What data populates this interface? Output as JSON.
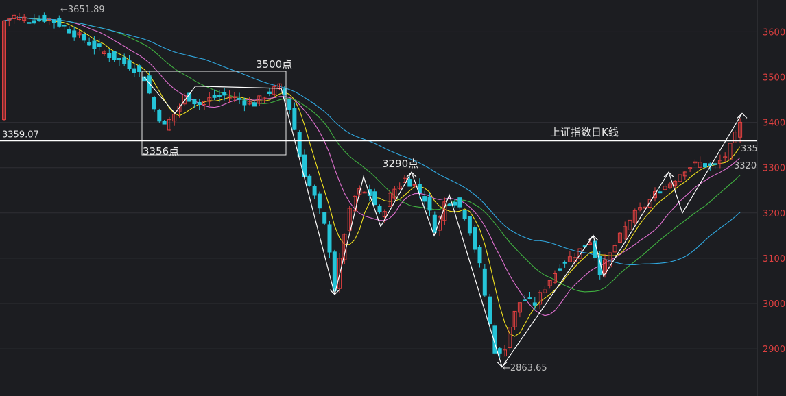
{
  "chart_data": {
    "type": "candlestick",
    "title": "上证指数日K线",
    "ylim": [
      2820,
      3680
    ],
    "y_ticks": [
      2900,
      3000,
      3100,
      3200,
      3300,
      3400,
      3500,
      3600
    ],
    "reference_line": {
      "value": 3359.07,
      "label": "3359.07"
    },
    "annotations": {
      "high": "←3651.89",
      "low": "←2863.65",
      "box_top": "3500点",
      "box_bottom": "3356点",
      "mid_peak": "3290点",
      "right_label_1": "335",
      "right_label_2": "3320"
    },
    "colors": {
      "up": "#e04040",
      "down": "#25c4d8",
      "ma5": "#ffffff",
      "ma10": "#f0e020",
      "ma20": "#e070d0",
      "ma30": "#40b040",
      "ma60": "#30a8e0"
    }
  }
}
